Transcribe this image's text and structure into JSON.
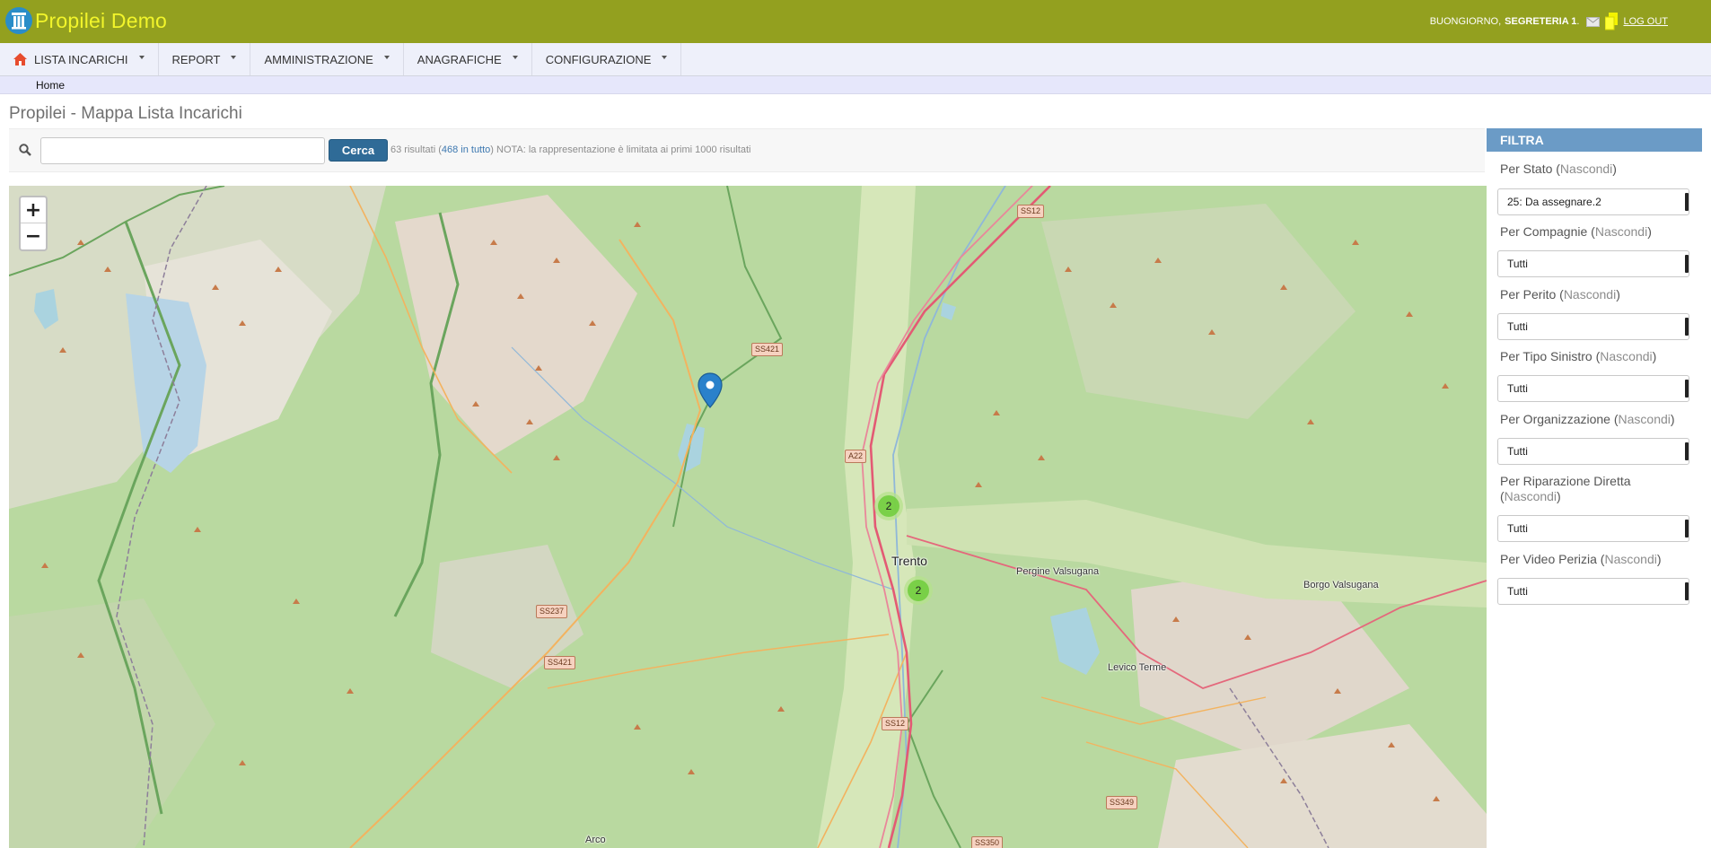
{
  "app": {
    "title": "Propilei Demo",
    "colors": {
      "topbar": "#93a01f",
      "title": "#f2f52b",
      "accent": "#2f6b97",
      "filter_header": "#6b9bc6"
    }
  },
  "user": {
    "greeting": "BUONGIORNO,",
    "name": "SEGRETERIA 1",
    "name_suffix": ".",
    "logout_label": "LOG OUT"
  },
  "nav": {
    "items": [
      {
        "label": "LISTA INCARICHI",
        "icon": "home-icon"
      },
      {
        "label": "REPORT"
      },
      {
        "label": "AMMINISTRAZIONE"
      },
      {
        "label": "ANAGRAFICHE"
      },
      {
        "label": "CONFIGURAZIONE"
      }
    ]
  },
  "breadcrumb": {
    "home": "Home"
  },
  "page": {
    "title": "Propilei - Mappa Lista Incarichi"
  },
  "search": {
    "value": "",
    "placeholder": "",
    "button_label": "Cerca",
    "results_count": "63 risultati (",
    "results_total_link": "468 in tutto",
    "results_note": ") NOTA: la rappresentazione è limitata ai primi 1000 risultati"
  },
  "map": {
    "zoom_in": "+",
    "zoom_out": "−",
    "clusters": [
      {
        "count": "2"
      },
      {
        "count": "2"
      }
    ],
    "towns": {
      "trento": "Trento",
      "pergine": "Pergine Valsugana",
      "borgo": "Borgo Valsugana",
      "levico": "Levico Terme",
      "arco": "Arco"
    },
    "roads": {
      "ss12_top": "SS12",
      "ss421_top": "SS421",
      "a22": "A22",
      "ss237": "SS237",
      "ss421_bottom": "SS421",
      "ss12_bottom": "SS12",
      "ss349": "SS349",
      "ss350": "SS350"
    }
  },
  "filter": {
    "title": "FILTRA",
    "hide_link": "Nascondi",
    "groups": [
      {
        "label": "Per Stato (",
        "selected": "25: Da assegnare.2"
      },
      {
        "label": "Per Compagnie (",
        "selected": "Tutti"
      },
      {
        "label": "Per Perito (",
        "selected": "Tutti"
      },
      {
        "label": "Per Tipo Sinistro (",
        "selected": "Tutti"
      },
      {
        "label": "Per Organizzazione (",
        "selected": "Tutti"
      },
      {
        "label": "Per Riparazione Diretta (",
        "selected": "Tutti"
      },
      {
        "label": "Per Video Perizia (",
        "selected": "Tutti"
      }
    ],
    "close_paren": ")"
  }
}
